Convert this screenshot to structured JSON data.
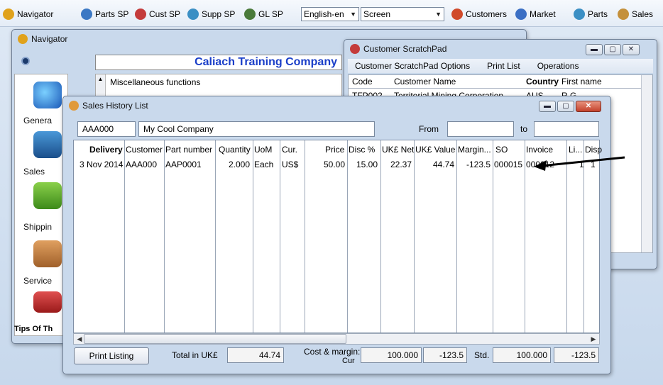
{
  "toolbar": {
    "items": [
      {
        "label": "Navigator",
        "icon": "navigator-icon",
        "color": "#e0a21b"
      },
      {
        "label": "Parts SP",
        "icon": "parts-sp-icon",
        "color": "#3b78c4"
      },
      {
        "label": "Cust SP",
        "icon": "cust-sp-icon",
        "color": "#c43b3b"
      },
      {
        "label": "Supp SP",
        "icon": "supp-sp-icon",
        "color": "#3b8fc4"
      },
      {
        "label": "GL SP",
        "icon": "gl-sp-icon",
        "color": "#4a7a3a"
      }
    ],
    "language": "English-en",
    "output": "Screen",
    "right_items": [
      {
        "label": "Customers",
        "icon": "customers-icon",
        "color": "#d04a2a"
      },
      {
        "label": "Market",
        "icon": "market-icon",
        "color": "#3b6fc4"
      },
      {
        "label": "Parts",
        "icon": "parts-icon",
        "color": "#3b8fc4"
      },
      {
        "label": "Sales",
        "icon": "sales-icon",
        "color": "#c4903b"
      }
    ]
  },
  "navigator": {
    "title": "Navigator",
    "company": "Caliach Training Company",
    "misc": "Miscellaneous functions",
    "categories": [
      "Genera",
      "Sales",
      "Shippin",
      "Service"
    ],
    "tips": "Tips Of Th"
  },
  "scratchpad": {
    "title": "Customer ScratchPad",
    "menu": [
      "Customer ScratchPad Options",
      "Print List",
      "Operations"
    ],
    "columns": [
      "Code",
      "Customer Name",
      "Country",
      "First name"
    ],
    "row": {
      "code": "TFP002",
      "name": "Territorial Mining Corporation",
      "country": "AUS",
      "first": "R.G."
    }
  },
  "sales": {
    "title": "Sales History List",
    "customer_code": "AAA000",
    "customer_name": "My Cool Company",
    "from_label": "From",
    "to_label": "to",
    "columns": [
      "Delivery",
      "Customer",
      "Part number",
      "Quantity",
      "UoM",
      "Cur.",
      "Price",
      "Disc %",
      "UK£ Net",
      "UK£ Value",
      "Margin...",
      "SO",
      "Invoice",
      "Li...",
      "Disp"
    ],
    "rows": [
      {
        "delivery": "3 Nov 2014",
        "customer": "AAA000",
        "part": "AAP0001",
        "qty": "2.000",
        "uom": "Each",
        "cur": "US$",
        "price": "50.00",
        "disc": "15.00",
        "net": "22.37",
        "value": "44.74",
        "margin": "-123.5",
        "so": "000015",
        "invoice": "000012",
        "li": "1",
        "disp": "1"
      }
    ],
    "print_button": "Print Listing",
    "total_label": "Total in UK£",
    "total_value": "44.74",
    "cost_label": "Cost & margin:",
    "cost_sub": "Cur",
    "cost_value": "100.000",
    "margin_value": "-123.5",
    "std_label": "Std.",
    "std_value": "100.000",
    "std_margin": "-123.5"
  }
}
